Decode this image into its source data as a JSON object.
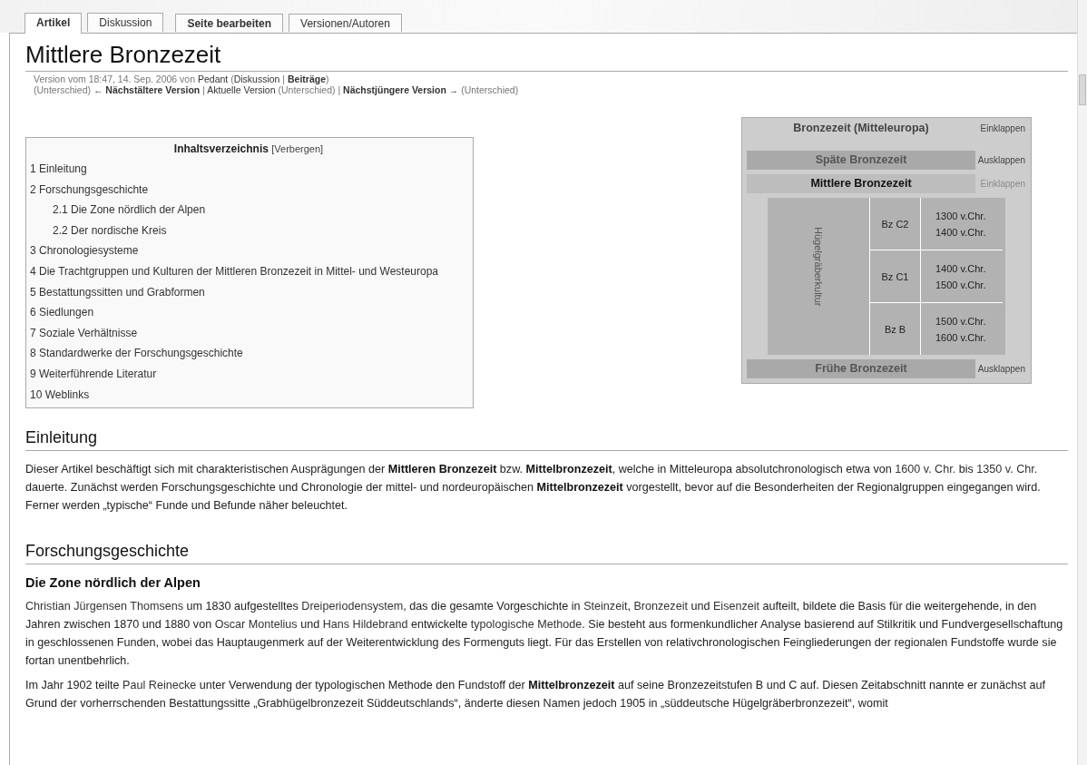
{
  "tab_groups": [
    [
      {
        "label": "Artikel",
        "selected": true,
        "bold": true
      },
      {
        "label": "Diskussion",
        "selected": false,
        "bold": false
      }
    ],
    [
      {
        "label": "Seite bearbeiten",
        "selected": false,
        "bold": true
      },
      {
        "label": "Versionen/Autoren",
        "selected": false,
        "bold": false
      }
    ]
  ],
  "title": "Mittlere Bronzezeit",
  "meta_lines": [
    [
      {
        "kind": "text",
        "text": "Version vom 18:47, 14. Sep. 2006 von "
      },
      {
        "kind": "link",
        "text": "Pedant"
      },
      {
        "kind": "text",
        "text": " ("
      },
      {
        "kind": "link",
        "text": "Diskussion"
      },
      {
        "kind": "text",
        "text": " | "
      },
      {
        "kind": "strong-link",
        "text": "Beiträge"
      },
      {
        "kind": "text",
        "text": ")"
      }
    ],
    [
      {
        "kind": "text",
        "text": "(Unterschied) "
      },
      {
        "kind": "strong-link",
        "text": "← Nächstältere Version"
      },
      {
        "kind": "text",
        "text": " | "
      },
      {
        "kind": "link",
        "text": "Aktuelle Version"
      },
      {
        "kind": "text",
        "text": " (Unterschied) | "
      },
      {
        "kind": "strong-link",
        "text": "Nächstjüngere Version →"
      },
      {
        "kind": "text",
        "text": " (Unterschied)"
      }
    ]
  ],
  "toc": {
    "title": "Inhaltsverzeichnis",
    "toggle": "[Verbergen]",
    "items": [
      {
        "label": "1 Einleitung"
      },
      {
        "label": "2 Forschungsgeschichte",
        "children": [
          {
            "label": "2.1 Die Zone nördlich der Alpen"
          },
          {
            "label": "2.2 Der nordische Kreis"
          }
        ]
      },
      {
        "label": "3 Chronologiesysteme"
      },
      {
        "label": "4 Die Trachtgruppen und Kulturen der Mittleren Bronzezeit in Mittel- und Westeuropa"
      },
      {
        "label": "5 Bestattungssitten und Grabformen"
      },
      {
        "label": "6 Siedlungen"
      },
      {
        "label": "7 Soziale Verhältnisse"
      },
      {
        "label": "8 Standardwerke der Forschungsgeschichte"
      },
      {
        "label": "9 Weiterführende Literatur"
      },
      {
        "label": "10 Weblinks"
      }
    ]
  },
  "infobox": {
    "title": "Bronzezeit (Mitteleuropa)",
    "toggle": "Einklappen",
    "periods": [
      {
        "name": "Späte Bronzezeit",
        "toggle": "Ausklappen",
        "expanded": false
      },
      {
        "name": "Mittlere Bronzezeit",
        "toggle": "Einklappen",
        "expanded": true,
        "culture": "Hügelgräberkultur",
        "phases": [
          {
            "stage": "Bz C2",
            "dates": [
              "1300 v.Chr.",
              "1400 v.Chr."
            ]
          },
          {
            "stage": "Bz C1",
            "dates": [
              "1400 v.Chr.",
              "1500 v.Chr."
            ]
          },
          {
            "stage": "Bz B",
            "dates": [
              "1500 v.Chr.",
              "1600 v.Chr."
            ]
          }
        ]
      },
      {
        "name": "Frühe Bronzezeit",
        "toggle": "Ausklappen",
        "expanded": false
      }
    ]
  },
  "sections": [
    {
      "kind": "h2",
      "text": "Einleitung"
    },
    {
      "kind": "p",
      "segments": [
        {
          "kind": "text",
          "text": "Dieser Artikel beschäftigt sich mit charakteristischen Ausprägungen der "
        },
        {
          "kind": "bold",
          "text": "Mittleren Bronzezeit"
        },
        {
          "kind": "text",
          "text": " bzw. "
        },
        {
          "kind": "bold",
          "text": "Mittelbronzezeit"
        },
        {
          "kind": "text",
          "text": ", welche in Mitteleuropa absolutchronologisch etwa von "
        },
        {
          "kind": "link",
          "text": "1600 v. Chr."
        },
        {
          "kind": "text",
          "text": " bis "
        },
        {
          "kind": "link",
          "text": "1350 v. Chr."
        },
        {
          "kind": "text",
          "text": " dauerte. Zunächst werden Forschungsgeschichte und Chronologie der mittel- und nordeuropäischen "
        },
        {
          "kind": "bold",
          "text": "Mittelbronzezeit"
        },
        {
          "kind": "text",
          "text": " vorgestellt, bevor auf die Besonderheiten der Regionalgruppen eingegangen wird. Ferner werden „typische“ Funde und Befunde näher beleuchtet."
        }
      ]
    },
    {
      "kind": "h2",
      "text": "Forschungsgeschichte"
    },
    {
      "kind": "h3",
      "text": "Die Zone nördlich der Alpen"
    },
    {
      "kind": "p",
      "segments": [
        {
          "kind": "link",
          "text": "Christian Jürgensen Thomsens"
        },
        {
          "kind": "text",
          "text": " um 1830 aufgestelltes "
        },
        {
          "kind": "link",
          "text": "Dreiperiodensystem"
        },
        {
          "kind": "text",
          "text": ", das die gesamte Vorgeschichte in "
        },
        {
          "kind": "link",
          "text": "Steinzeit"
        },
        {
          "kind": "text",
          "text": ", "
        },
        {
          "kind": "link",
          "text": "Bronzezeit"
        },
        {
          "kind": "text",
          "text": " und "
        },
        {
          "kind": "link",
          "text": "Eisenzeit"
        },
        {
          "kind": "text",
          "text": " aufteilt, bildete die Basis für die weitergehende, in den Jahren zwischen 1870 und 1880 von "
        },
        {
          "kind": "link",
          "text": "Oscar Montelius"
        },
        {
          "kind": "text",
          "text": " und "
        },
        {
          "kind": "link",
          "text": "Hans Hildebrand"
        },
        {
          "kind": "text",
          "text": " entwickelte "
        },
        {
          "kind": "link",
          "text": "typologische Methode"
        },
        {
          "kind": "text",
          "text": ". Sie besteht aus formenkundlicher Analyse basierend auf Stilkritik und Fundvergesellschaftung in geschlossenen Funden, wobei das Hauptaugenmerk auf der Weiterentwicklung des Formenguts liegt. Für das Erstellen von relativchronologischen Feingliederungen der regionalen Fundstoffe wurde sie fortan unentbehrlich."
        }
      ]
    },
    {
      "kind": "p",
      "segments": [
        {
          "kind": "text",
          "text": "Im Jahr 1902 teilte "
        },
        {
          "kind": "link",
          "text": "Paul Reinecke"
        },
        {
          "kind": "text",
          "text": " unter Verwendung der typologischen Methode den Fundstoff der "
        },
        {
          "kind": "bold",
          "text": "Mittelbronzezeit"
        },
        {
          "kind": "text",
          "text": " auf seine Bronzezeitstufen B und C auf. Diesen Zeitabschnitt nannte er zunächst auf Grund der vorherrschenden Bestattungssitte „Grabhügelbronzezeit Süddeutschlands“, änderte diesen Namen jedoch 1905 in „süddeutsche Hügelgräberbronzezeit“, womit"
        }
      ]
    }
  ]
}
